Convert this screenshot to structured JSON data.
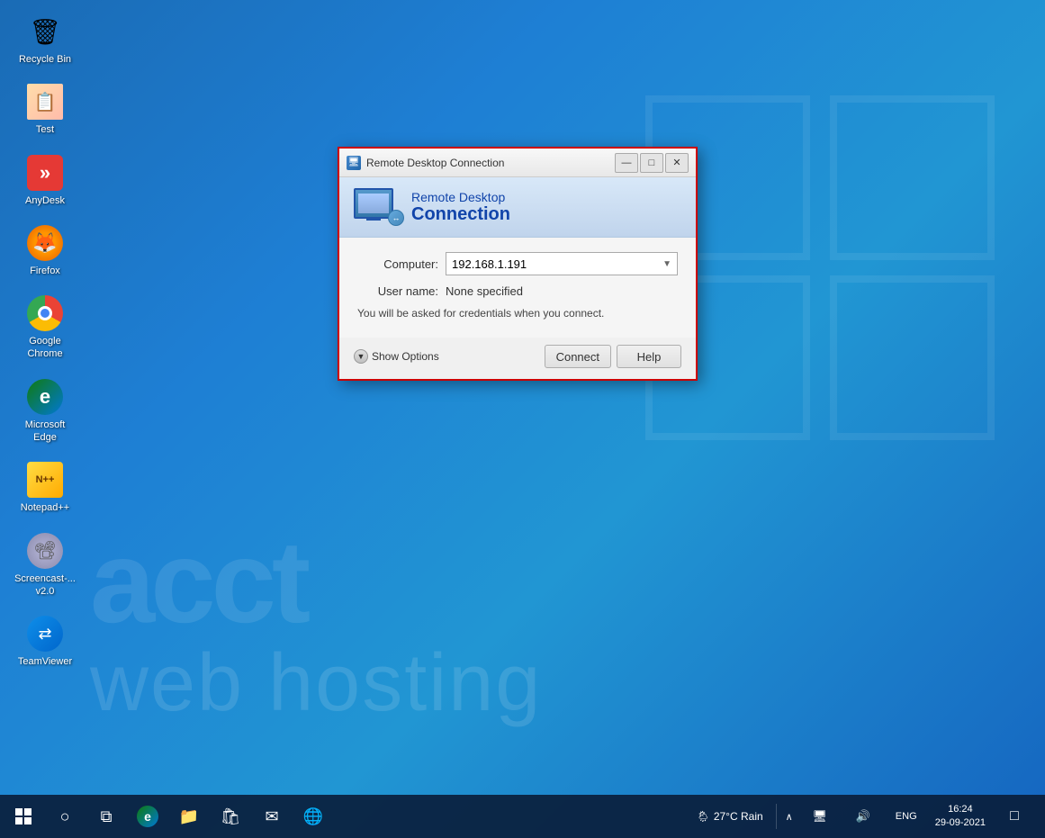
{
  "desktop": {
    "background_colors": [
      "#1a6bb5",
      "#2196d3",
      "#1565c0"
    ],
    "watermark_line1": "acct",
    "watermark_line2": "web hosting"
  },
  "desktop_icons": [
    {
      "id": "recycle-bin",
      "label": "Recycle Bin",
      "icon_type": "recycle"
    },
    {
      "id": "test",
      "label": "Test",
      "icon_type": "test"
    },
    {
      "id": "anydesk",
      "label": "AnyDesk",
      "icon_type": "anydesk"
    },
    {
      "id": "firefox",
      "label": "Firefox",
      "icon_type": "firefox"
    },
    {
      "id": "google-chrome",
      "label": "Google Chrome",
      "icon_type": "chrome"
    },
    {
      "id": "microsoft-edge",
      "label": "Microsoft Edge",
      "icon_type": "edge"
    },
    {
      "id": "notepadpp",
      "label": "Notepad++",
      "icon_type": "notepadpp"
    },
    {
      "id": "screencast",
      "label": "Screencast-...\nv2.0",
      "icon_type": "screencast"
    },
    {
      "id": "teamviewer",
      "label": "TeamViewer",
      "icon_type": "teamviewer"
    }
  ],
  "dialog": {
    "title": "Remote Desktop Connection",
    "header_line1": "Remote Desktop",
    "header_line2": "Connection",
    "computer_label": "Computer:",
    "computer_value": "192.168.1.191",
    "username_label": "User name:",
    "username_value": "None specified",
    "info_text": "You will be asked for credentials when you connect.",
    "show_options_label": "Show Options",
    "connect_button": "Connect",
    "help_button": "Help"
  },
  "titlebar": {
    "minimize": "—",
    "maximize": "□",
    "close": "✕"
  },
  "taskbar": {
    "start_icon": "⊞",
    "search_icon": "○",
    "task_view_icon": "⊟",
    "edge_icon": "e",
    "files_icon": "📁",
    "store_icon": "🛍",
    "mail_icon": "✉",
    "network_icon": "🌐",
    "weather_text": "27°C Rain",
    "weather_icon": "🌦",
    "sys_icons": "∧  🔊",
    "language": "ENG",
    "time": "16:24",
    "date": "29-09-2021",
    "notification_icon": "🔔"
  }
}
